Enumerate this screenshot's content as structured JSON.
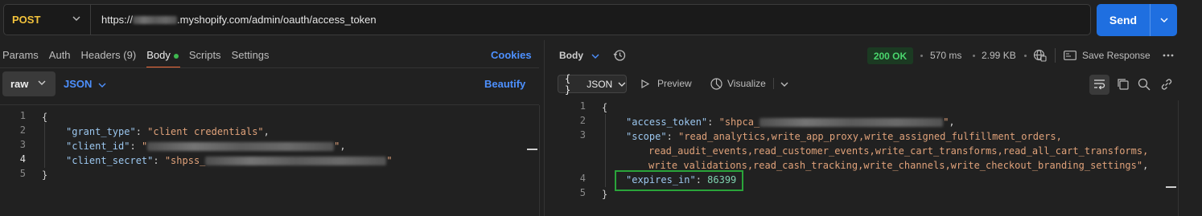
{
  "request": {
    "method": "POST",
    "url_suffix": ".myshopify.com/admin/oauth/access_token",
    "url_prefix": "https://",
    "send_label": "Send"
  },
  "request_tabs": [
    "Params",
    "Auth",
    "Headers (9)",
    "Body",
    "Scripts",
    "Settings"
  ],
  "active_tab": "Body",
  "cookies_label": "Cookies",
  "body_mode": "raw",
  "body_format": "JSON",
  "beautify_label": "Beautify",
  "request_body": {
    "line_numbers": [
      "1",
      "2",
      "3",
      "4",
      "5"
    ],
    "open_brace": "{",
    "close_brace": "}",
    "grant_type_key": "\"grant_type\"",
    "grant_type_value": "\"client credentials\"",
    "client_id_key": "\"client_id\"",
    "client_id_value_open": "\"",
    "client_id_value_close": "\"",
    "client_secret_key": "\"client_secret\"",
    "client_secret_value_open": "\"shpss_",
    "client_secret_value_close": "\""
  },
  "response": {
    "body_label": "Body",
    "status": "200 OK",
    "time": "570 ms",
    "size": "2.99 KB",
    "save_label": "Save Response",
    "format": "JSON",
    "preview_label": "Preview",
    "visualize_label": "Visualize",
    "line_numbers": [
      "1",
      "2",
      "3",
      "4",
      "5"
    ],
    "open_brace": "{",
    "close_brace": "}",
    "access_token_key": "\"access_token\"",
    "access_token_value_open": "\"shpca_",
    "access_token_value_close": "\"",
    "scope_key": "\"scope\"",
    "scope_line1": "\"read_analytics,write_app_proxy,write_assigned_fulfillment_orders,",
    "scope_line2": "read_audit_events,read_customer_events,write_cart_transforms,read_all_cart_transforms,",
    "scope_line3": "write_validations,read_cash_tracking,write_channels,write_checkout_branding_settings\"",
    "expires_in_key": "\"expires_in\"",
    "expires_in_value": "86399"
  },
  "colors": {
    "accent": "#1f6fe0",
    "method": "#f3c33c",
    "status_ok": "#4ad66d",
    "highlight": "#2aa43a"
  }
}
